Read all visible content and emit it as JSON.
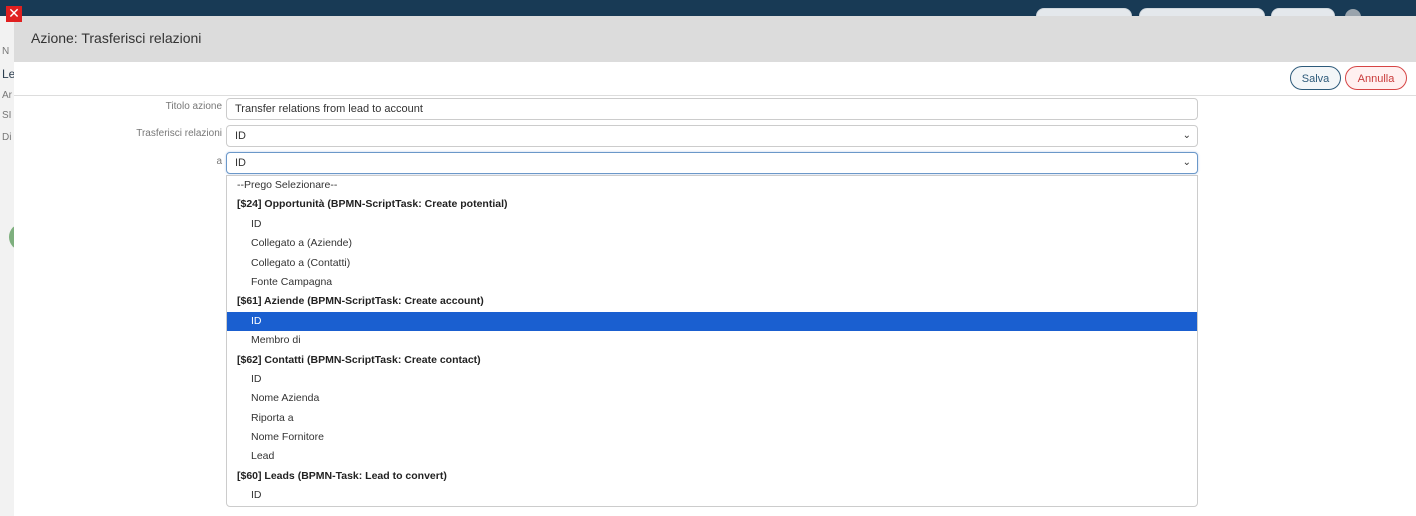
{
  "modal": {
    "title": "Azione: Trasferisci relazioni",
    "close_glyph": "✕",
    "buttons": {
      "save": "Salva",
      "cancel": "Annulla"
    }
  },
  "background": {
    "left_fragments": [
      "N",
      "Le",
      "Ar",
      "SI",
      "Di"
    ]
  },
  "form": {
    "action_title_label": "Titolo azione",
    "action_title_value": "Transfer relations from lead to account",
    "transfer_label": "Trasferisci relazioni",
    "transfer_value": "ID",
    "to_label": "a",
    "to_value": "ID",
    "caret_glyph": "⌄"
  },
  "dropdown": {
    "options": [
      {
        "label": "--Prego Selezionare--",
        "type": "plain"
      },
      {
        "label": "[$24] Opportunità (BPMN-ScriptTask: Create potential)",
        "type": "group"
      },
      {
        "label": "ID",
        "type": "sub"
      },
      {
        "label": "Collegato a (Aziende)",
        "type": "sub"
      },
      {
        "label": "Collegato a (Contatti)",
        "type": "sub"
      },
      {
        "label": "Fonte Campagna",
        "type": "sub"
      },
      {
        "label": "[$61] Aziende (BPMN-ScriptTask: Create account)",
        "type": "group"
      },
      {
        "label": "ID",
        "type": "sub",
        "selected": true
      },
      {
        "label": "Membro di",
        "type": "sub"
      },
      {
        "label": "[$62] Contatti (BPMN-ScriptTask: Create contact)",
        "type": "group"
      },
      {
        "label": "ID",
        "type": "sub"
      },
      {
        "label": "Nome Azienda",
        "type": "sub"
      },
      {
        "label": "Riporta a",
        "type": "sub"
      },
      {
        "label": "Nome Fornitore",
        "type": "sub"
      },
      {
        "label": "Lead",
        "type": "sub"
      },
      {
        "label": "[$60] Leads (BPMN-Task: Lead to convert)",
        "type": "group"
      },
      {
        "label": "ID",
        "type": "sub"
      }
    ]
  },
  "colors": {
    "selected_option": "#1a5fd0",
    "header_bg": "#dcdcdc",
    "close_red": "#e02020",
    "save_border": "#2d5a7a",
    "cancel_border": "#d64545"
  }
}
